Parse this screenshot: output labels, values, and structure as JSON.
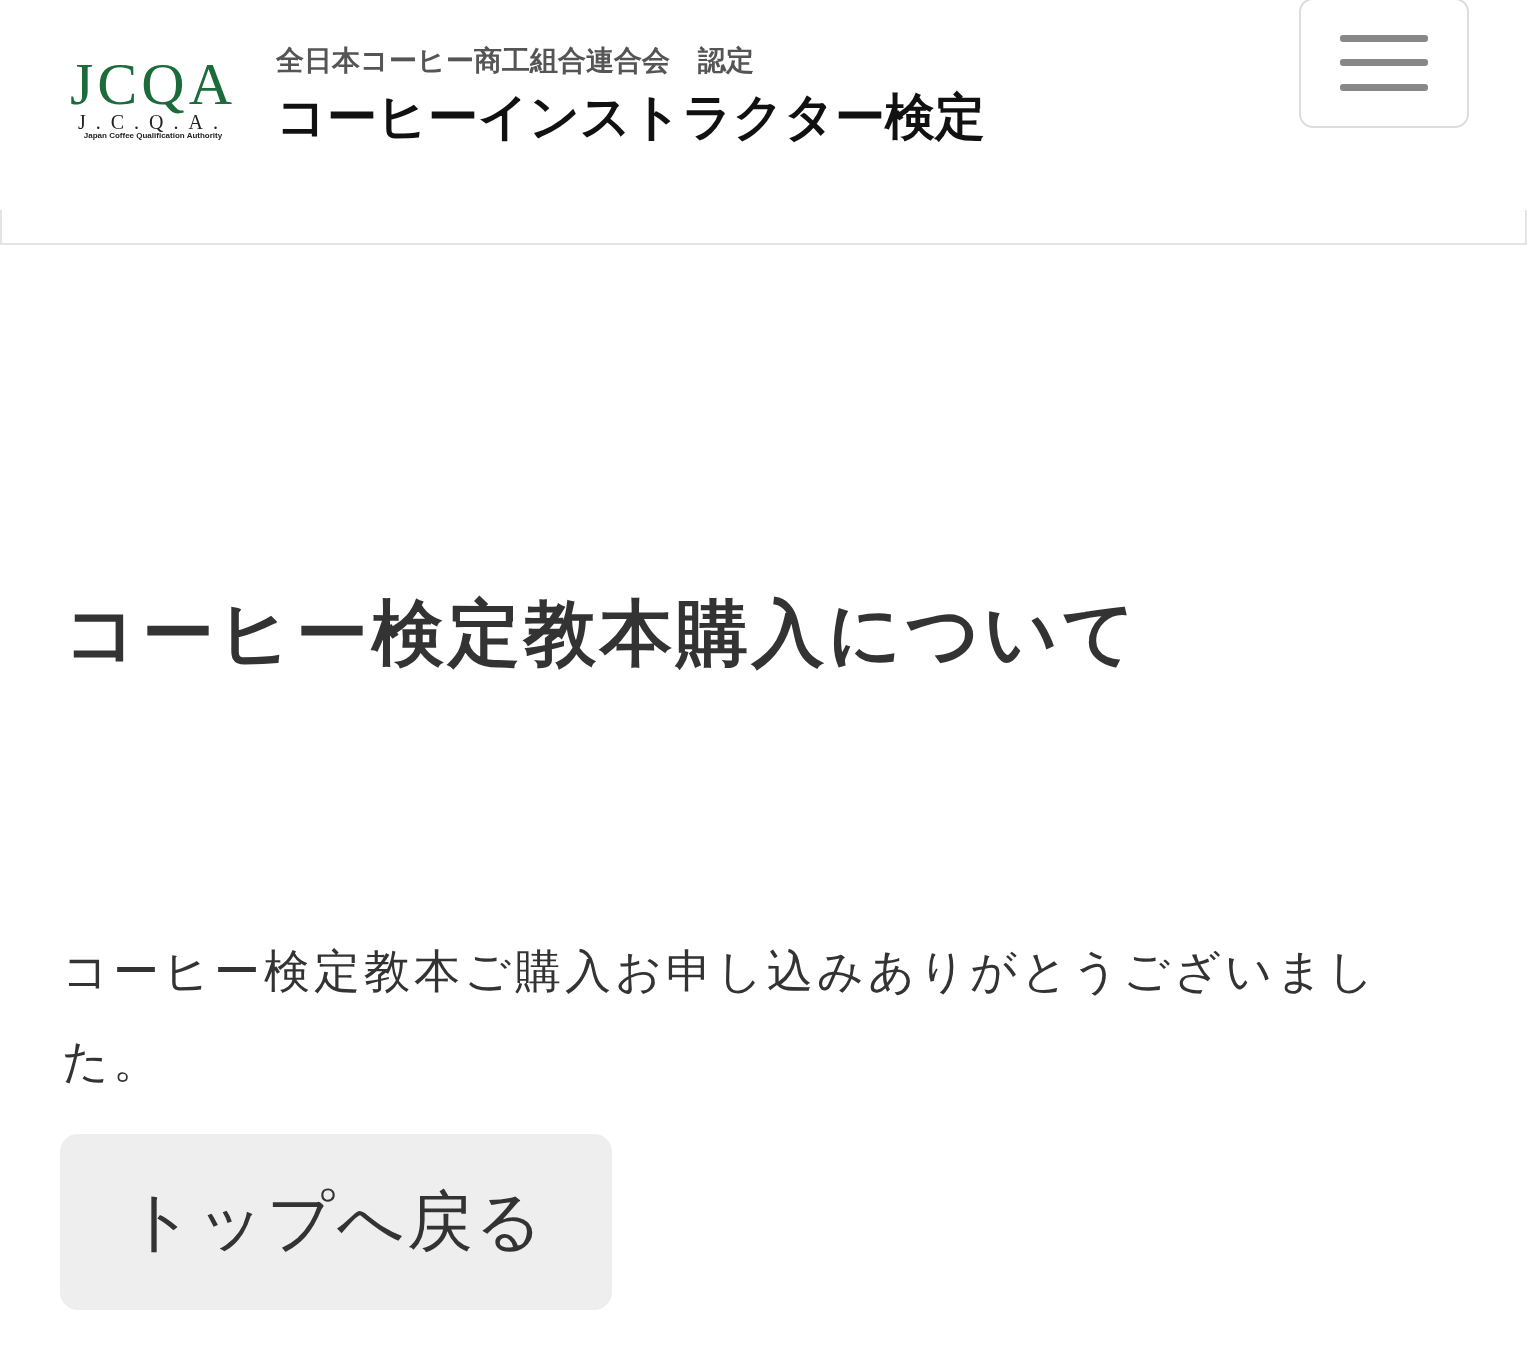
{
  "header": {
    "logo": {
      "letters": "JCQA",
      "dotted": "J.C.Q.A.",
      "tagline": "Japan Coffee Qualification Authority"
    },
    "org": "全日本コーヒー商工組合連合会　認定",
    "title": "コーヒーインストラクター検定"
  },
  "page": {
    "heading": "コーヒー検定教本購入について",
    "message": "コーヒー検定教本ご購入お申し込みありがとうございました。",
    "button": "トップへ戻る"
  }
}
